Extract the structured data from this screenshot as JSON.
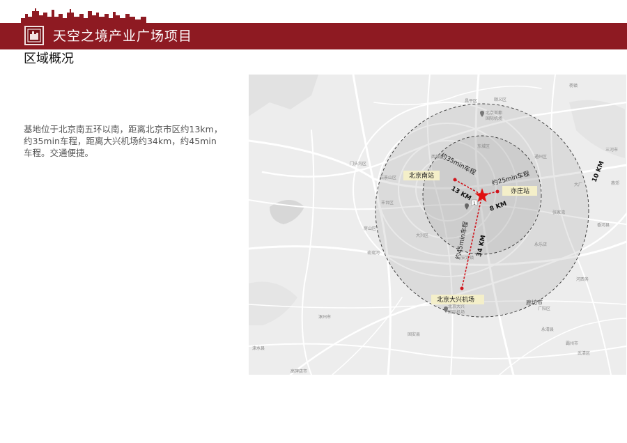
{
  "header": {
    "title": "天空之境产业广场项目"
  },
  "section": {
    "heading": "区域概况"
  },
  "description": {
    "lines": [
      "基地位于北京南五环以南，距离北京市区约13km，",
      "约35min车程，距离大兴机场约34km，约45min",
      "车程。交通便捷。"
    ]
  },
  "map": {
    "stations": {
      "beijing_south": "北京南站",
      "yizhuang": "亦庄站",
      "daxing_airport": "北京大兴机场"
    },
    "routes": {
      "to_beijing_south": {
        "time": "约35min车程",
        "distance": "13 KM"
      },
      "to_yizhuang": {
        "time": "约25min车程",
        "distance": "8 KM"
      },
      "to_airport": {
        "time": "约45min车程",
        "distance": "34 KM"
      },
      "outer_radius": "10 KM"
    },
    "place_labels": {
      "shunyi": "顺义区",
      "capital_airport": "北京首都\n国际机场",
      "mentougou": "门头沟区",
      "shijingshan": "石景山区",
      "fengtai": "丰台区",
      "fangshan": "房山区",
      "daxing": "大兴区",
      "langfang": "廊坊市",
      "zhuozhou": "涿州市",
      "gu_an": "固安县",
      "daxing_airport_area": "北京大兴\n国际机场",
      "tongzhou": "通州区",
      "sanhe": "三河市",
      "xianghe": "香河县",
      "dachang": "大厂",
      "yanjiao": "燕郊",
      "changping": "昌平区",
      "bazhou": "霸州市",
      "yongqing": "永清县",
      "wuqing": "武清区",
      "laishui": "涞水县",
      "gaobeidian": "高碑店市",
      "dongcheng": "东城区",
      "xicheng": "西城区",
      "yongledian": "永乐店",
      "anding": "安定镇",
      "liulihe": "琉璃河",
      "hexibu": "河西务",
      "guangyang": "广阳区",
      "yangfang": "杨镇",
      "zhangjiawan": "张家湾"
    },
    "colors": {
      "route": "#d0141c",
      "star": "#e01010",
      "ring_fill": "#9a9a9a",
      "label_bg": "#f4efc9"
    }
  }
}
